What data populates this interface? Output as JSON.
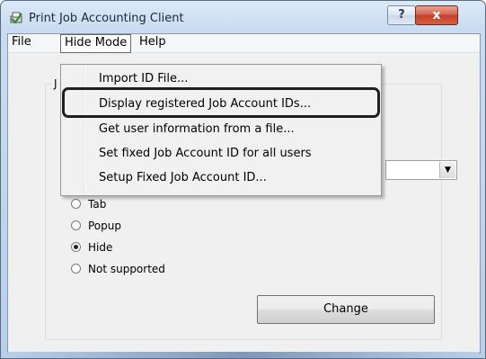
{
  "window": {
    "title": "Print Job Accounting Client",
    "help_glyph": "?",
    "close_glyph": "x"
  },
  "menubar": {
    "file": "File",
    "hide_mode": "Hide Mode",
    "help": "Help"
  },
  "hide_mode_menu": {
    "items": [
      "Import ID File...",
      "Display registered Job Account IDs...",
      "Get user information from a file...",
      "Set fixed Job Account ID for all users",
      "Setup Fixed Job Account ID..."
    ],
    "highlighted_index": 1
  },
  "group": {
    "label_fragment": "J"
  },
  "combo": {
    "arrow_glyph": "▼"
  },
  "radios": {
    "options": [
      "Tab",
      "Popup",
      "Hide",
      "Not supported"
    ],
    "selected": "Hide"
  },
  "buttons": {
    "change": "Change"
  }
}
